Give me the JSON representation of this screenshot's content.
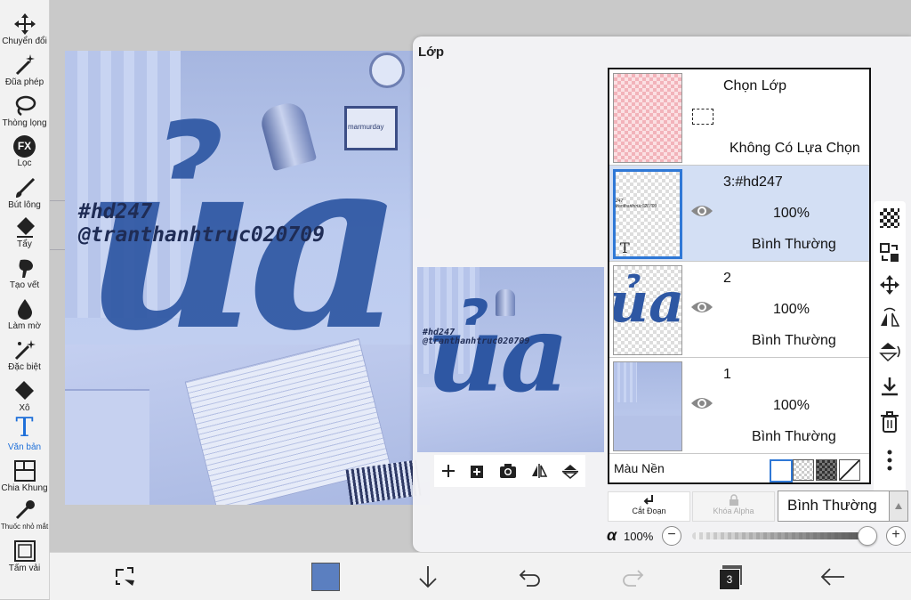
{
  "toolbar": {
    "tools": [
      {
        "label": "Chuyển đổi",
        "icon": "move-icon"
      },
      {
        "label": "Đũa phép",
        "icon": "magic-wand-icon"
      },
      {
        "label": "Thòng lọng",
        "icon": "lasso-icon"
      },
      {
        "label": "Lọc",
        "icon": "fx-filter-icon",
        "badge": "FX"
      },
      {
        "label": "Bút lông",
        "icon": "brush-icon"
      },
      {
        "label": "Tẩy",
        "icon": "eraser-icon"
      },
      {
        "label": "Tạo vết",
        "icon": "smudge-icon"
      },
      {
        "label": "Làm mờ",
        "icon": "blur-icon"
      },
      {
        "label": "Đặc biệt",
        "icon": "special-icon"
      },
      {
        "label": "Xô",
        "icon": "bucket-icon"
      },
      {
        "label": "Văn bản",
        "icon": "text-tool-icon",
        "glyph": "T"
      },
      {
        "label": "Chia Khung",
        "icon": "frame-divider-icon"
      },
      {
        "label": "Thuốc nhỏ mắt",
        "icon": "eyedropper-icon"
      },
      {
        "label": "Tấm vải",
        "icon": "canvas-icon"
      }
    ],
    "active_tool": "Văn bản",
    "active_color": "#1e6fd9"
  },
  "artwork": {
    "hashtag": "#hd247",
    "handle": "@tranthanhtruc020709",
    "script_text": "ủa",
    "thumb_text": "ủa",
    "frame_text": "marmurday",
    "text_color": "#1f2c55",
    "script_color": "#2e57a3"
  },
  "layers_panel": {
    "title": "Lớp",
    "selection_layer": {
      "name": "Chọn Lớp",
      "status": "Không Có Lựa Chọn"
    },
    "layers": [
      {
        "name": "3:#hd247",
        "opacity": "100%",
        "mode": "Bình Thường",
        "selected": true,
        "type_glyph": "T",
        "thumb_text": "247\ntranthanhtruc020709"
      },
      {
        "name": "2",
        "opacity": "100%",
        "mode": "Bình Thường",
        "selected": false
      },
      {
        "name": "1",
        "opacity": "100%",
        "mode": "Bình Thường",
        "selected": false
      }
    ],
    "background": {
      "label": "Màu Nền"
    },
    "clip_button": "Cắt Đoạn",
    "alpha_lock_button": "Khóa Alpha",
    "blend_mode": "Bình Thường",
    "alpha_symbol": "α",
    "alpha_value": "100%",
    "opacity_fraction": 1.0,
    "accent": "#2f78d6"
  },
  "bottombar": {
    "primary_color": "#5b7fc0",
    "layer_count": "3"
  }
}
